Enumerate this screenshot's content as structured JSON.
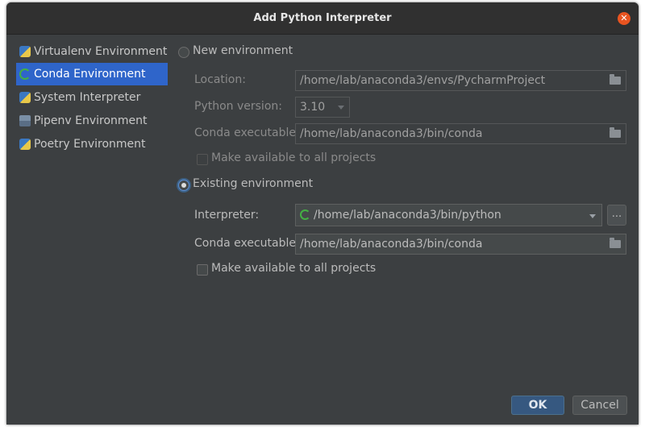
{
  "dialog": {
    "title": "Add Python Interpreter",
    "close_icon": "close-icon"
  },
  "sidebar": {
    "items": [
      {
        "label": "Virtualenv Environment",
        "icon": "python-icon"
      },
      {
        "label": "Conda Environment",
        "icon": "conda-icon",
        "selected": true
      },
      {
        "label": "System Interpreter",
        "icon": "python-icon"
      },
      {
        "label": "Pipenv Environment",
        "icon": "pipenv-icon"
      },
      {
        "label": "Poetry Environment",
        "icon": "python-icon"
      }
    ]
  },
  "new_env": {
    "radio_label": "New environment",
    "location_label": "Location:",
    "location_value": "/home/lab/anaconda3/envs/PycharmProject",
    "python_version_label": "Python version:",
    "python_version_value": "3.10",
    "conda_exec_label": "Conda executable:",
    "conda_exec_value": "/home/lab/anaconda3/bin/conda",
    "make_available_label": "Make available to all projects"
  },
  "existing_env": {
    "radio_label": "Existing environment",
    "interpreter_label": "Interpreter:",
    "interpreter_value": "/home/lab/anaconda3/bin/python",
    "browse_label": "...",
    "conda_exec_label": "Conda executable:",
    "conda_exec_value": "/home/lab/anaconda3/bin/conda",
    "make_available_label": "Make available to all projects"
  },
  "footer": {
    "ok_label": "OK",
    "cancel_label": "Cancel"
  },
  "colors": {
    "accent": "#2f65ca",
    "close": "#e95420",
    "primary_button": "#365880",
    "background": "#3c3f41"
  }
}
